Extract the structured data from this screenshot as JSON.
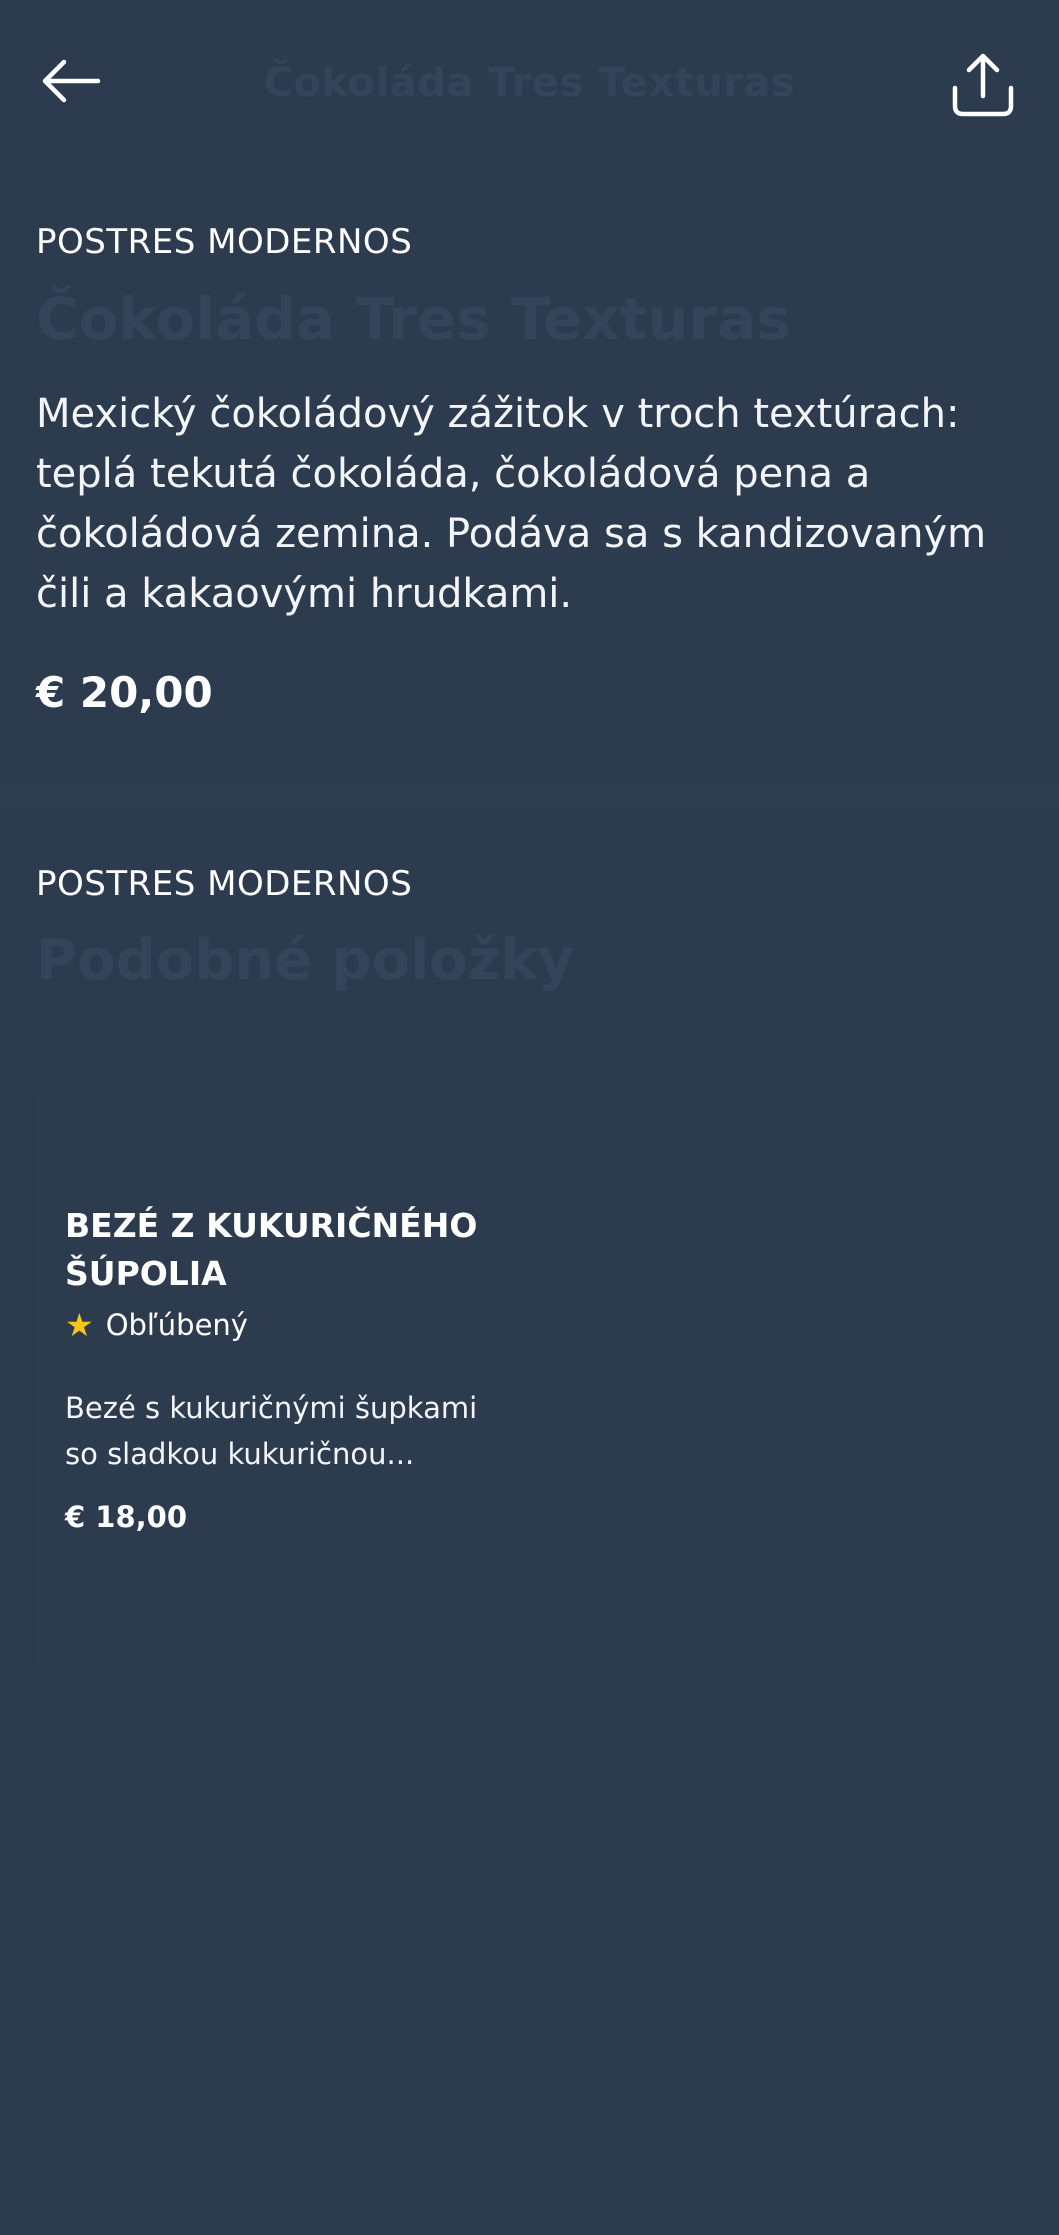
{
  "header": {
    "title": "Čokoláda Tres Texturas",
    "back_icon": "arrow-left-icon",
    "share_icon": "share-icon"
  },
  "product": {
    "category": "POSTRES MODERNOS",
    "title": "Čokoláda Tres Texturas",
    "description": "Mexický čokoládový zážitok v troch textúrach: teplá tekutá čokoláda, čokoládová pena a čokoládová zemina. Podáva sa s kandizovaným čili a kakaovými hrudkami.",
    "price": "€ 20,00"
  },
  "similar": {
    "category": "POSTRES MODERNOS",
    "title": "Podobné položky",
    "items": [
      {
        "name": "BEZÉ Z KUKURIČNÉHO ŠÚPOLIA",
        "badge": "Obľúbený",
        "badge_icon": "star-icon",
        "description": "Bezé s kukuričnými šupkami so sladkou kukuričnou...",
        "price": "€ 18,00"
      }
    ]
  },
  "colors": {
    "background": "#2c3b4e",
    "muted_title": "#34445a",
    "star": "#f5c518",
    "text": "#ffffff"
  }
}
